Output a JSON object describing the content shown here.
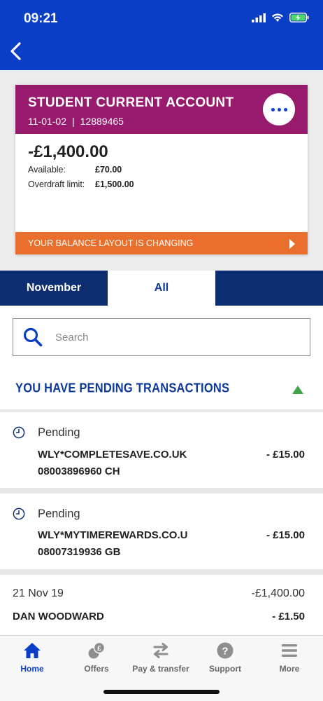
{
  "status_bar": {
    "time": "09:21"
  },
  "account": {
    "name": "STUDENT CURRENT ACCOUNT",
    "sort_code": "11-01-02",
    "separator": "|",
    "account_number": "12889465",
    "balance": "-£1,400.00",
    "available_label": "Available:",
    "available_value": "£70.00",
    "overdraft_label": "Overdraft limit:",
    "overdraft_value": "£1,500.00",
    "banner_text": "YOUR BALANCE LAYOUT IS CHANGING"
  },
  "tabs": [
    {
      "label": "November"
    },
    {
      "label": "All"
    }
  ],
  "search": {
    "placeholder": "Search"
  },
  "pending": {
    "title": "YOU HAVE PENDING TRANSACTIONS",
    "items": [
      {
        "status": "Pending",
        "merchant_line1": "WLY*COMPLETESAVE.CO.UK",
        "merchant_line2": "08003896960  CH",
        "amount": "- £15.00"
      },
      {
        "status": "Pending",
        "merchant_line1": "WLY*MYTIMEREWARDS.CO.U",
        "merchant_line2": "08007319936  GB",
        "amount": "- £15.00"
      }
    ]
  },
  "posted": {
    "date": "21 Nov 19",
    "day_total": "-£1,400.00",
    "items": [
      {
        "name": "DAN WOODWARD",
        "amount": "- £1.50"
      }
    ]
  },
  "bottom_nav": [
    {
      "label": "Home",
      "icon": "home-icon"
    },
    {
      "label": "Offers",
      "icon": "offers-icon"
    },
    {
      "label": "Pay & transfer",
      "icon": "transfer-icon"
    },
    {
      "label": "Support",
      "icon": "support-icon"
    },
    {
      "label": "More",
      "icon": "menu-icon"
    }
  ],
  "colors": {
    "brand_blue": "#0b3ec7",
    "navy": "#0e2e72",
    "account_purple": "#971a6d",
    "banner_orange": "#ea6e2c",
    "pending_green": "#3fa44a"
  }
}
